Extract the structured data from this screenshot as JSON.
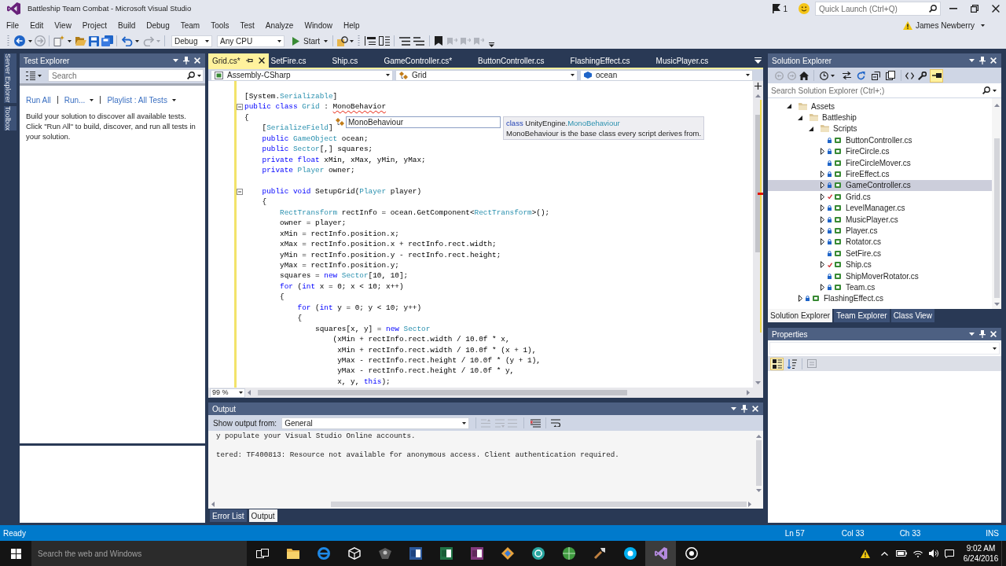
{
  "window": {
    "title": "Battleship Team Combat - Microsoft Visual Studio"
  },
  "title_bar": {
    "notifications": "1",
    "quick_launch": {
      "placeholder": "Quick Launch (Ctrl+Q)"
    }
  },
  "menu": [
    "File",
    "Edit",
    "View",
    "Project",
    "Build",
    "Debug",
    "Team",
    "Tools",
    "Test",
    "Analyze",
    "Window",
    "Help"
  ],
  "account": {
    "name": "James Newberry",
    "warning": true
  },
  "toolbar": {
    "configuration": "Debug",
    "platform": "Any CPU",
    "start": "Start"
  },
  "side_tabs": [
    "Server Explorer",
    "Toolbox"
  ],
  "test_explorer": {
    "title": "Test Explorer",
    "search": {
      "placeholder": "Search"
    },
    "links": [
      {
        "label": "Run All",
        "dropdown": false
      },
      {
        "label": "Run...",
        "dropdown": true
      },
      {
        "label": "Playlist : All Tests",
        "dropdown": true
      }
    ],
    "message": "Build your solution to discover all available tests. Click \"Run All\" to build, discover, and run all tests in your solution."
  },
  "editor": {
    "tabs": [
      {
        "label": "Grid.cs*",
        "selected": true
      },
      {
        "label": "SetFire.cs",
        "selected": false
      },
      {
        "label": "Ship.cs",
        "selected": false
      },
      {
        "label": "GameController.cs*",
        "selected": false
      },
      {
        "label": "ButtonController.cs",
        "selected": false
      },
      {
        "label": "FlashingEffect.cs",
        "selected": false
      },
      {
        "label": "MusicPlayer.cs",
        "selected": false
      }
    ],
    "navigation": [
      {
        "label": "Assembly-CSharp",
        "kind": "project"
      },
      {
        "label": "Grid",
        "kind": "class"
      },
      {
        "label": "ocean",
        "kind": "field"
      }
    ],
    "lines": [
      {
        "kind": "code",
        "fold": false,
        "tokens": [
          {
            "text": "[System.",
            "kind": "plain"
          },
          {
            "text": "Serializable",
            "kind": "type"
          },
          {
            "text": "]",
            "kind": "plain"
          }
        ]
      },
      {
        "kind": "code",
        "fold": true,
        "tokens": [
          {
            "text": "public class ",
            "kind": "keyword"
          },
          {
            "text": "Grid",
            "kind": "type"
          },
          {
            "text": " : ",
            "kind": "plain"
          },
          {
            "text": "MonoBehavior",
            "kind": "error"
          }
        ]
      },
      {
        "kind": "code",
        "fold": false,
        "tokens": [
          {
            "text": "{",
            "kind": "plain"
          }
        ]
      },
      {
        "kind": "code",
        "fold": false,
        "tokens": [
          {
            "text": "    [",
            "kind": "plain"
          },
          {
            "text": "SerializeField",
            "kind": "type"
          },
          {
            "text": "]",
            "kind": "plain"
          }
        ]
      },
      {
        "kind": "code",
        "fold": false,
        "tokens": [
          {
            "text": "    public ",
            "kind": "keyword"
          },
          {
            "text": "GameObject",
            "kind": "type"
          },
          {
            "text": " ocean;",
            "kind": "plain"
          }
        ]
      },
      {
        "kind": "code",
        "fold": false,
        "tokens": [
          {
            "text": "    public ",
            "kind": "keyword"
          },
          {
            "text": "Sector",
            "kind": "type"
          },
          {
            "text": "[,] squares;",
            "kind": "plain"
          }
        ]
      },
      {
        "kind": "code",
        "fold": false,
        "tokens": [
          {
            "text": "    private float",
            "kind": "keyword"
          },
          {
            "text": " xMin, xMax, yMin, yMax;",
            "kind": "plain"
          }
        ]
      },
      {
        "kind": "code",
        "fold": false,
        "tokens": [
          {
            "text": "    private ",
            "kind": "keyword"
          },
          {
            "text": "Player",
            "kind": "type"
          },
          {
            "text": " owner;",
            "kind": "plain"
          }
        ]
      },
      {
        "kind": "blank"
      },
      {
        "kind": "code",
        "fold": true,
        "tokens": [
          {
            "text": "    public void",
            "kind": "keyword"
          },
          {
            "text": " SetupGrid(",
            "kind": "plain"
          },
          {
            "text": "Player",
            "kind": "type"
          },
          {
            "text": " player)",
            "kind": "plain"
          }
        ]
      },
      {
        "kind": "code",
        "fold": false,
        "tokens": [
          {
            "text": "    {",
            "kind": "plain"
          }
        ]
      },
      {
        "kind": "code",
        "fold": false,
        "tokens": [
          {
            "text": "        RectTransform",
            "kind": "type"
          },
          {
            "text": " rectInfo = ocean.GetComponent<",
            "kind": "plain"
          },
          {
            "text": "RectTransform",
            "kind": "type"
          },
          {
            "text": ">();",
            "kind": "plain"
          }
        ]
      },
      {
        "kind": "code",
        "fold": false,
        "tokens": [
          {
            "text": "        owner = player;",
            "kind": "plain"
          }
        ]
      },
      {
        "kind": "code",
        "fold": false,
        "tokens": [
          {
            "text": "        xMin = rectInfo.position.x;",
            "kind": "plain"
          }
        ]
      },
      {
        "kind": "code",
        "fold": false,
        "tokens": [
          {
            "text": "        xMax = rectInfo.position.x + rectInfo.rect.width;",
            "kind": "plain"
          }
        ]
      },
      {
        "kind": "code",
        "fold": false,
        "tokens": [
          {
            "text": "        yMin = rectInfo.position.y - rectInfo.rect.height;",
            "kind": "plain"
          }
        ]
      },
      {
        "kind": "code",
        "fold": false,
        "tokens": [
          {
            "text": "        yMax = rectInfo.position.y;",
            "kind": "plain"
          }
        ]
      },
      {
        "kind": "code",
        "fold": false,
        "tokens": [
          {
            "text": "        squares = ",
            "kind": "plain"
          },
          {
            "text": "new ",
            "kind": "keyword"
          },
          {
            "text": "Sector",
            "kind": "type"
          },
          {
            "text": "[10, 10];",
            "kind": "plain"
          }
        ]
      },
      {
        "kind": "code",
        "fold": false,
        "tokens": [
          {
            "text": "        for",
            "kind": "keyword"
          },
          {
            "text": " (",
            "kind": "plain"
          },
          {
            "text": "int",
            "kind": "keyword"
          },
          {
            "text": " x = 0; x < 10; x++)",
            "kind": "plain"
          }
        ]
      },
      {
        "kind": "code",
        "fold": false,
        "tokens": [
          {
            "text": "        {",
            "kind": "plain"
          }
        ]
      },
      {
        "kind": "code",
        "fold": false,
        "tokens": [
          {
            "text": "            for",
            "kind": "keyword"
          },
          {
            "text": " (",
            "kind": "plain"
          },
          {
            "text": "int",
            "kind": "keyword"
          },
          {
            "text": " y = 0; y < 10; y++)",
            "kind": "plain"
          }
        ]
      },
      {
        "kind": "code",
        "fold": false,
        "tokens": [
          {
            "text": "            {",
            "kind": "plain"
          }
        ]
      },
      {
        "kind": "code",
        "fold": false,
        "tokens": [
          {
            "text": "                squares[x, y] = ",
            "kind": "plain"
          },
          {
            "text": "new ",
            "kind": "keyword"
          },
          {
            "text": "Sector",
            "kind": "type"
          }
        ]
      },
      {
        "kind": "code",
        "fold": false,
        "tokens": [
          {
            "text": "                    (xMin + rectInfo.rect.width / 10.0f * x,",
            "kind": "plain"
          }
        ]
      },
      {
        "kind": "code",
        "fold": false,
        "tokens": [
          {
            "text": "                     xMin + rectInfo.rect.width / 10.0f * (x + 1),",
            "kind": "plain"
          }
        ]
      },
      {
        "kind": "code",
        "fold": false,
        "tokens": [
          {
            "text": "                     yMax - rectInfo.rect.height / 10.0f * (y + 1),",
            "kind": "plain"
          }
        ]
      },
      {
        "kind": "code",
        "fold": false,
        "tokens": [
          {
            "text": "                     yMax - rectInfo.rect.height / 10.0f * y,",
            "kind": "plain"
          }
        ]
      },
      {
        "kind": "code",
        "fold": false,
        "tokens": [
          {
            "text": "                     x, y, ",
            "kind": "plain"
          },
          {
            "text": "this",
            "kind": "keyword"
          },
          {
            "text": ");",
            "kind": "plain"
          }
        ]
      }
    ],
    "completion": {
      "items": [
        {
          "label": "MonoBehaviour",
          "selected": true
        }
      ]
    },
    "quick_info": {
      "signature": [
        {
          "text": "class ",
          "kind": "keyword"
        },
        {
          "text": "UnityEngine.",
          "kind": "plain"
        },
        {
          "text": "MonoBehaviour",
          "kind": "type"
        }
      ],
      "description": "MonoBehaviour is the base class every script derives from."
    },
    "zoom": "99 %"
  },
  "output": {
    "title": "Output",
    "source_label": "Show output from:",
    "source": "General",
    "lines": [
      {
        "kind": "text",
        "text": "y populate your Visual Studio Online accounts."
      },
      {
        "kind": "blank"
      },
      {
        "kind": "text",
        "text": "tered: TF400813: Resource not available for anonymous access. Client authentication required."
      }
    ],
    "tabs": [
      {
        "label": "Error List",
        "selected": false
      },
      {
        "label": "Output",
        "selected": true
      }
    ]
  },
  "solution_explorer": {
    "title": "Solution Explorer",
    "preview_selected_items": true,
    "search": {
      "placeholder": "Search Solution Explorer (Ctrl+;)"
    },
    "tree": [
      {
        "label": "Assets",
        "kind": "folder",
        "expanded": true,
        "selected": false,
        "children": [
          {
            "label": "Battleship",
            "kind": "folder",
            "expanded": true,
            "selected": false,
            "children": [
              {
                "label": "Scripts",
                "kind": "folder",
                "expanded": true,
                "selected": false,
                "children": [
                  {
                    "label": "ButtonController.cs",
                    "kind": "file",
                    "selected": false,
                    "pending_edit": false
                  },
                  {
                    "label": "FireCircle.cs",
                    "kind": "file",
                    "expanded": false,
                    "selected": false,
                    "pending_edit": false
                  },
                  {
                    "label": "FireCircleMover.cs",
                    "kind": "file",
                    "selected": false,
                    "pending_edit": false
                  },
                  {
                    "label": "FireEffect.cs",
                    "kind": "file",
                    "expanded": false,
                    "selected": false,
                    "pending_edit": false
                  },
                  {
                    "label": "GameController.cs",
                    "kind": "file",
                    "expanded": false,
                    "selected": true,
                    "pending_edit": false
                  },
                  {
                    "label": "Grid.cs",
                    "kind": "file",
                    "expanded": false,
                    "selected": false,
                    "pending_edit": true
                  },
                  {
                    "label": "LevelManager.cs",
                    "kind": "file",
                    "expanded": false,
                    "selected": false,
                    "pending_edit": false
                  },
                  {
                    "label": "MusicPlayer.cs",
                    "kind": "file",
                    "expanded": false,
                    "selected": false,
                    "pending_edit": false
                  },
                  {
                    "label": "Player.cs",
                    "kind": "file",
                    "expanded": false,
                    "selected": false,
                    "pending_edit": false
                  },
                  {
                    "label": "Rotator.cs",
                    "kind": "file",
                    "expanded": false,
                    "selected": false,
                    "pending_edit": false
                  },
                  {
                    "label": "SetFire.cs",
                    "kind": "file",
                    "selected": false,
                    "pending_edit": false
                  },
                  {
                    "label": "Ship.cs",
                    "kind": "file",
                    "expanded": false,
                    "selected": false,
                    "pending_edit": true
                  },
                  {
                    "label": "ShipMoverRotator.cs",
                    "kind": "file",
                    "selected": false,
                    "pending_edit": false
                  },
                  {
                    "label": "Team.cs",
                    "kind": "file",
                    "expanded": false,
                    "selected": false,
                    "pending_edit": false
                  }
                ]
              }
            ]
          },
          {
            "label": "FlashingEffect.cs",
            "kind": "file",
            "expanded": false,
            "selected": false,
            "pending_edit": false
          }
        ]
      }
    ],
    "tabs": [
      {
        "label": "Solution Explorer",
        "selected": true
      },
      {
        "label": "Team Explorer",
        "selected": false
      },
      {
        "label": "Class View",
        "selected": false
      }
    ]
  },
  "properties": {
    "title": "Properties",
    "categorized": true
  },
  "status_bar": {
    "message": "Ready",
    "line": "Ln 57",
    "column": "Col 33",
    "character": "Ch 33",
    "mode": "INS"
  },
  "taskbar": {
    "search": {
      "placeholder": "Search the web and Windows"
    },
    "apps": [
      {
        "kind": "task-view",
        "selected": false
      },
      {
        "kind": "folder",
        "selected": false
      },
      {
        "kind": "browser",
        "selected": false
      },
      {
        "kind": "cube",
        "selected": false
      },
      {
        "kind": "dark-app",
        "selected": false
      },
      {
        "kind": "document",
        "selected": false
      },
      {
        "kind": "spreadsheet",
        "selected": false
      },
      {
        "kind": "notebook",
        "selected": false
      },
      {
        "kind": "diamond",
        "selected": false
      },
      {
        "kind": "teal-circle",
        "selected": false
      },
      {
        "kind": "green-circle",
        "selected": false
      },
      {
        "kind": "tool",
        "selected": false
      },
      {
        "kind": "chat",
        "selected": false
      },
      {
        "kind": "infinity",
        "selected": true
      },
      {
        "kind": "record",
        "selected": false
      }
    ],
    "time": "9:02 AM",
    "date": "6/24/2016"
  }
}
